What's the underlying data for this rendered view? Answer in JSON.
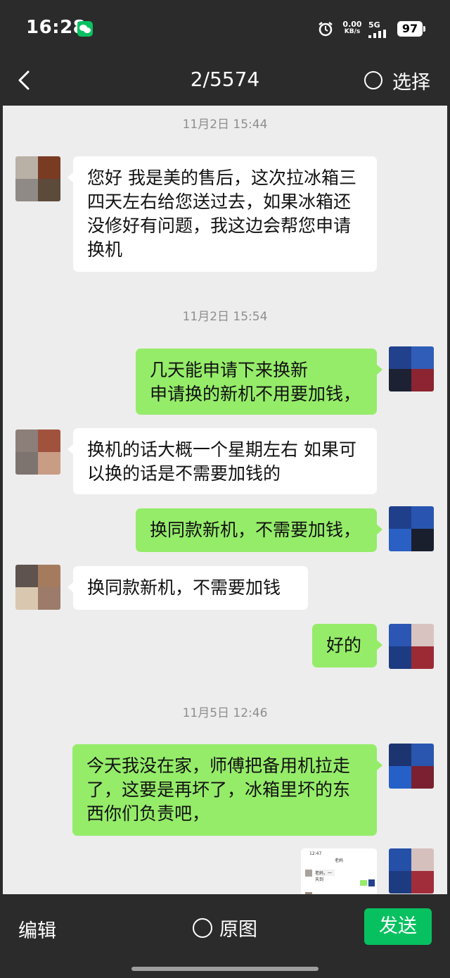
{
  "status_bar": {
    "time": "16:28",
    "net_speed_value": "0.00",
    "net_speed_unit": "KB/s",
    "network": "5G",
    "battery": "97",
    "icons": [
      "wechat-icon",
      "alarm-icon",
      "signal-icon",
      "battery-icon"
    ]
  },
  "header": {
    "counter": "2/5574",
    "select_label": "选择"
  },
  "messages": {
    "ts1": "11月2日 15:44",
    "m1": "您好 我是美的售后，这次拉冰箱三四天左右给您送过去，如果冰箱还没修好有问题，我这边会帮您申请换机",
    "ts2": "11月2日 15:54",
    "m2_line1": "几天能申请下来换新",
    "m2_line2": "申请换的新机不用要加钱，",
    "m3": " 换机的话大概一个星期左右 如果可以换的话是不需要加钱的",
    "m4": "换同款新机，不需要加钱，",
    "m5": "换同款新机，不需要加钱",
    "m6": "好的",
    "ts3": "11月5日 12:46",
    "m7": "今天我没在家，师傅把备用机拉走了，这要是再坏了，冰箱里坏的东西你们负责吧，"
  },
  "thumbnail": {
    "time": "12:47",
    "title": "老妈",
    "snippet": "老妈，一天到"
  },
  "bottom_bar": {
    "edit_label": "编辑",
    "original_label": "原图",
    "send_label": "发送"
  },
  "colors": {
    "bar_bg": "#2b2b2b",
    "chat_bg": "#ededed",
    "bubble_self": "#95ec69",
    "bubble_other": "#ffffff",
    "accent": "#07c160"
  }
}
